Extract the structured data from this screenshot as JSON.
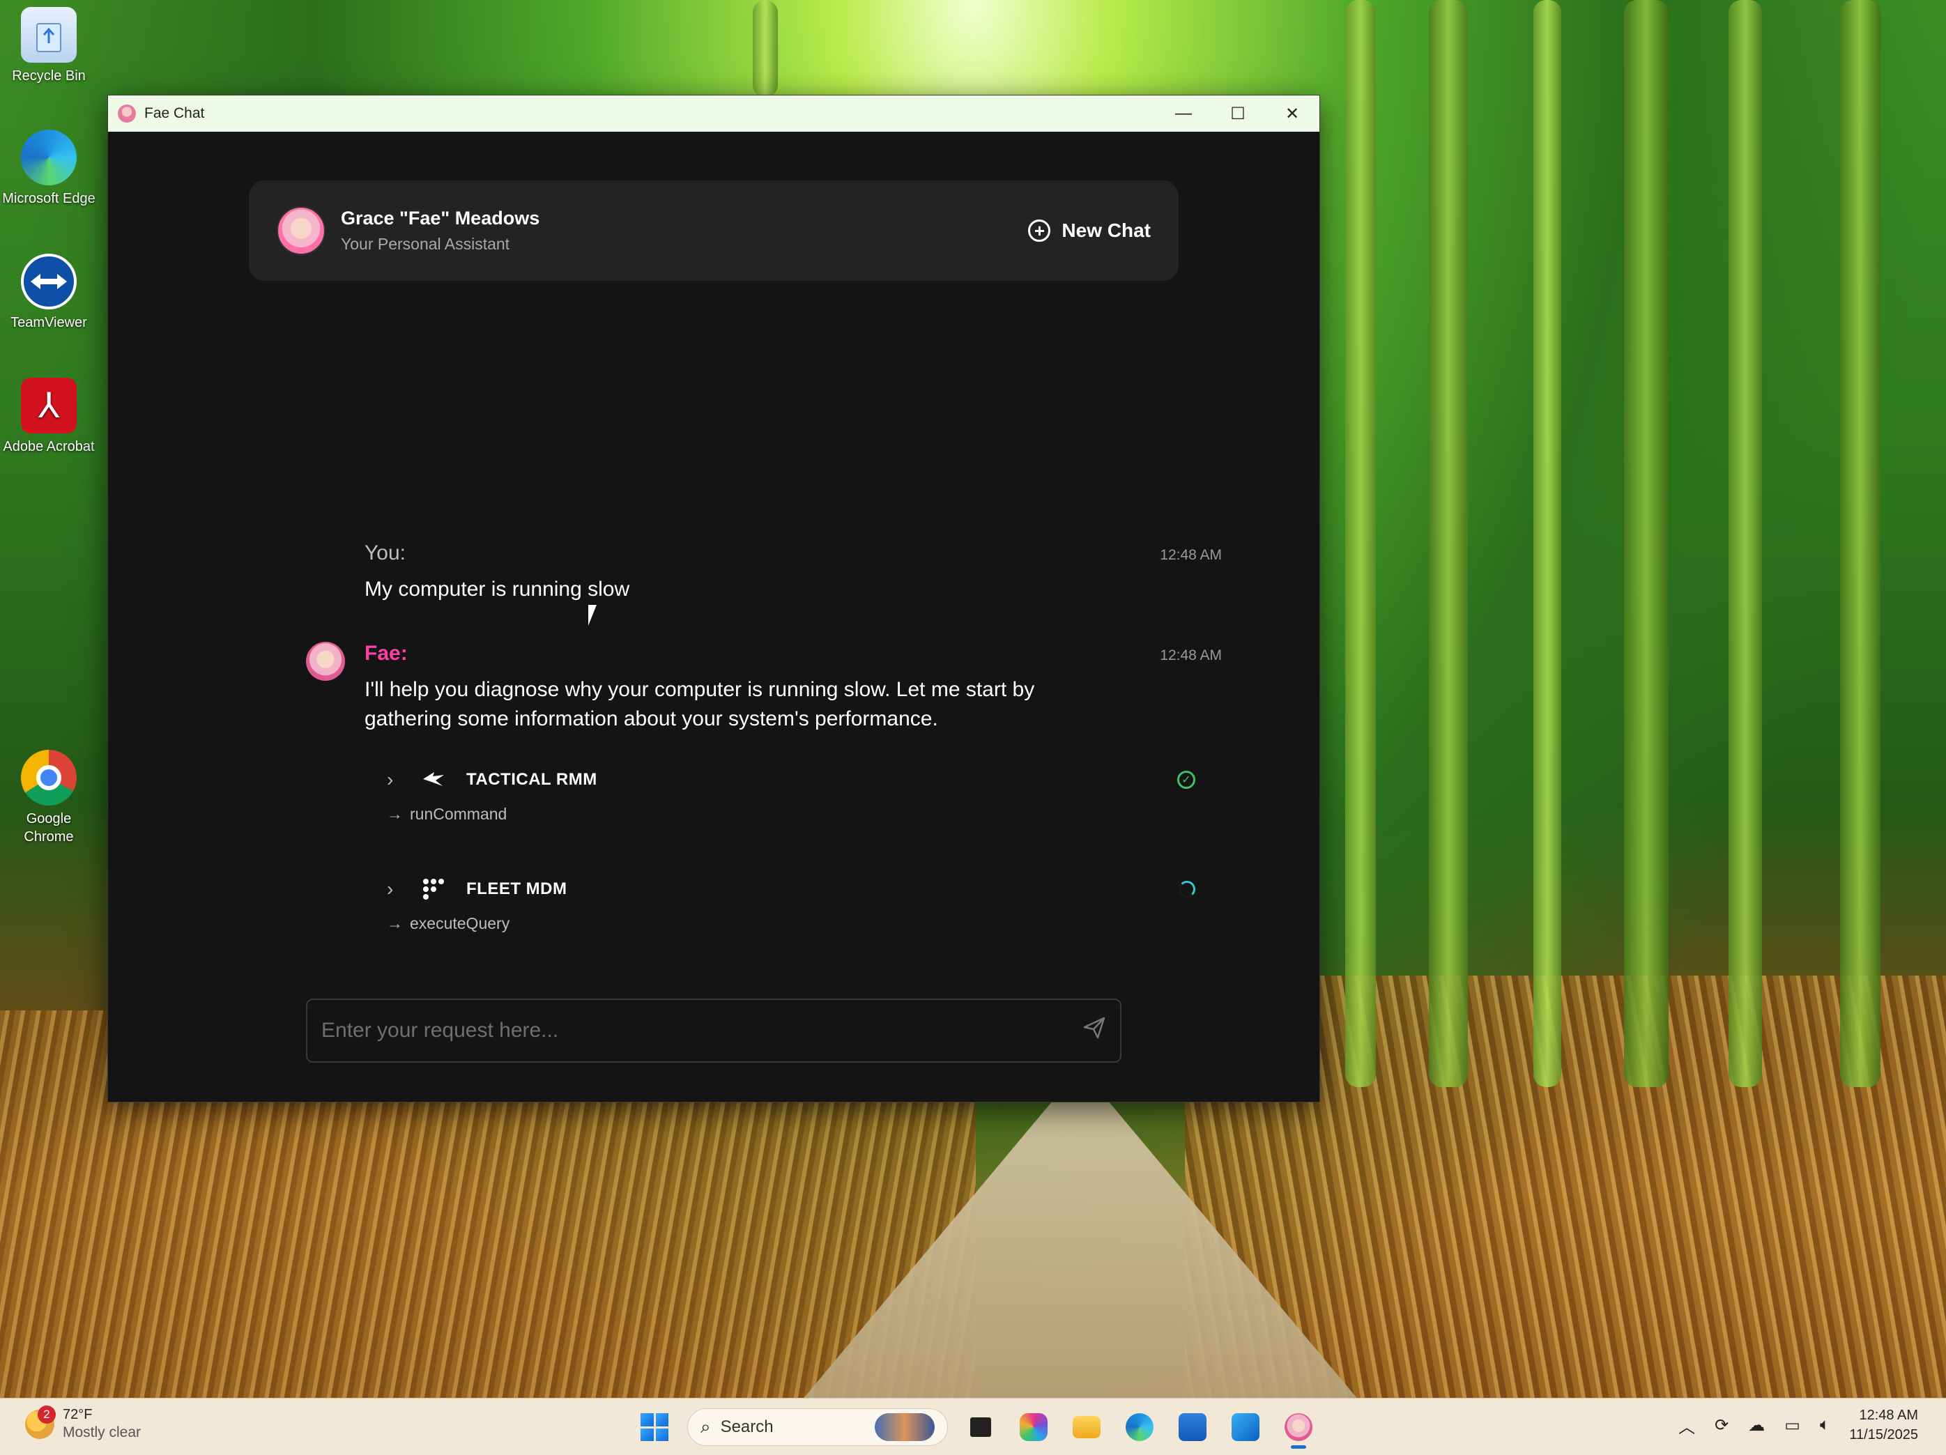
{
  "desktop": {
    "icons": [
      {
        "label": "Recycle Bin"
      },
      {
        "label": "Microsoft Edge"
      },
      {
        "label": "TeamViewer"
      },
      {
        "label": "Adobe Acrobat"
      },
      {
        "label": "Google Chrome"
      }
    ]
  },
  "window": {
    "title": "Fae Chat",
    "controls": {
      "minimize": "—",
      "maximize": "☐",
      "close": "✕"
    }
  },
  "header": {
    "name": "Grace \"Fae\" Meadows",
    "subtitle": "Your Personal Assistant",
    "new_chat_label": "New Chat"
  },
  "messages": [
    {
      "author": "You:",
      "time": "12:48 AM",
      "text": "My computer is running slow"
    },
    {
      "author": "Fae:",
      "time": "12:48 AM",
      "text": "I'll help you diagnose why your computer is running slow. Let me start by gathering some information about your system's performance."
    }
  ],
  "tools": [
    {
      "name": "TACTICAL RMM",
      "action": "runCommand",
      "status": "complete",
      "icon": "tactical-rmm-icon"
    },
    {
      "name": "FLEET MDM",
      "action": "executeQuery",
      "status": "loading",
      "icon": "fleet-mdm-icon"
    }
  ],
  "input": {
    "placeholder": "Enter your request here...",
    "value": ""
  },
  "taskbar": {
    "weather": {
      "temp": "72°F",
      "condition": "Mostly clear",
      "badge": "2"
    },
    "search_label": "Search",
    "clock_time": "12:48 AM",
    "clock_date": "11/15/2025"
  },
  "colors": {
    "accent_pink": "#ff3fa7",
    "success_green": "#3dc16b",
    "spinner_cyan": "#33c7d6",
    "window_bg": "#141414"
  }
}
